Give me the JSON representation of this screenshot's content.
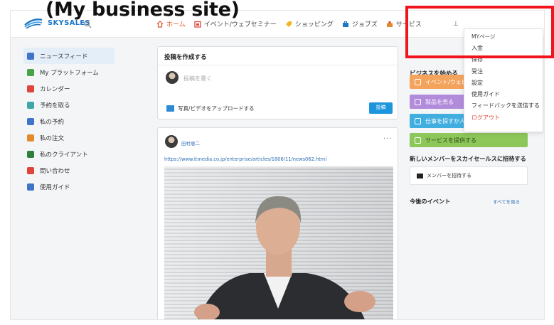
{
  "caption": "(My business site)",
  "brand": {
    "name": "SKYSALES",
    "accent": "#1c76c8"
  },
  "nav": {
    "items": [
      {
        "label": "ホーム",
        "icon": "home-icon",
        "active": true
      },
      {
        "label": "イベント/ウェブセミナー",
        "icon": "calendar-icon"
      },
      {
        "label": "ショッピング",
        "icon": "tag-icon"
      },
      {
        "label": "ジョブズ",
        "icon": "briefcase-icon"
      },
      {
        "label": "サービス",
        "icon": "service-icon"
      }
    ],
    "right_icon": "⊥"
  },
  "sidebar": {
    "items": [
      {
        "label": "ニュースフィード",
        "color": "#3f74c9",
        "active": true
      },
      {
        "label": "My プラットフォーム",
        "color": "#47a24a"
      },
      {
        "label": "カレンダー",
        "color": "#e0453b"
      },
      {
        "label": "予約を取る",
        "color": "#3fa7a8"
      },
      {
        "label": "私の予約",
        "color": "#3f74c9"
      },
      {
        "label": "私の注文",
        "color": "#e38b2c"
      },
      {
        "label": "私のクライアント",
        "color": "#2f7f3f"
      },
      {
        "label": "問い合わせ",
        "color": "#e0453b"
      },
      {
        "label": "使用ガイド",
        "color": "#3f74c9"
      }
    ]
  },
  "composer": {
    "title": "投稿を作成する",
    "placeholder": "投稿を書く",
    "upload_label": "写真/ビデオをアップロードする",
    "post_button": "投稿"
  },
  "post": {
    "author": "田村恵二",
    "more": "···",
    "link": "https://www.itmedia.co.jp/enterprise/articles/1806/11/news062.html"
  },
  "right": {
    "title": "ビジネスを始める",
    "ctas": [
      {
        "label": "イベント/ウェビナー",
        "color": "#f4a35d"
      },
      {
        "label": "製品を売る",
        "color": "#b28bdb"
      },
      {
        "label": "仕事を探すか人",
        "color": "#41aee0"
      },
      {
        "label": "サービスを提供する",
        "color": "#8dc75a"
      }
    ],
    "invite_title": "新しいメンバーをスカイセールスに招待する",
    "invite_button": "メンバーを招待する",
    "events_title": "今後のイベント",
    "events_all": "すべてを見る"
  },
  "dropdown": {
    "items": [
      {
        "label": "MYページ",
        "kind": "header"
      },
      {
        "label": "入金"
      },
      {
        "label": "保存"
      },
      {
        "label": "受注"
      },
      {
        "label": "設定"
      },
      {
        "label": "使用ガイド"
      },
      {
        "label": "フィードバックを送信する"
      },
      {
        "label": "ログアウト",
        "kind": "logout"
      }
    ]
  },
  "colors": {
    "highlight": "#f0141c",
    "post_button": "#1c95dd"
  }
}
